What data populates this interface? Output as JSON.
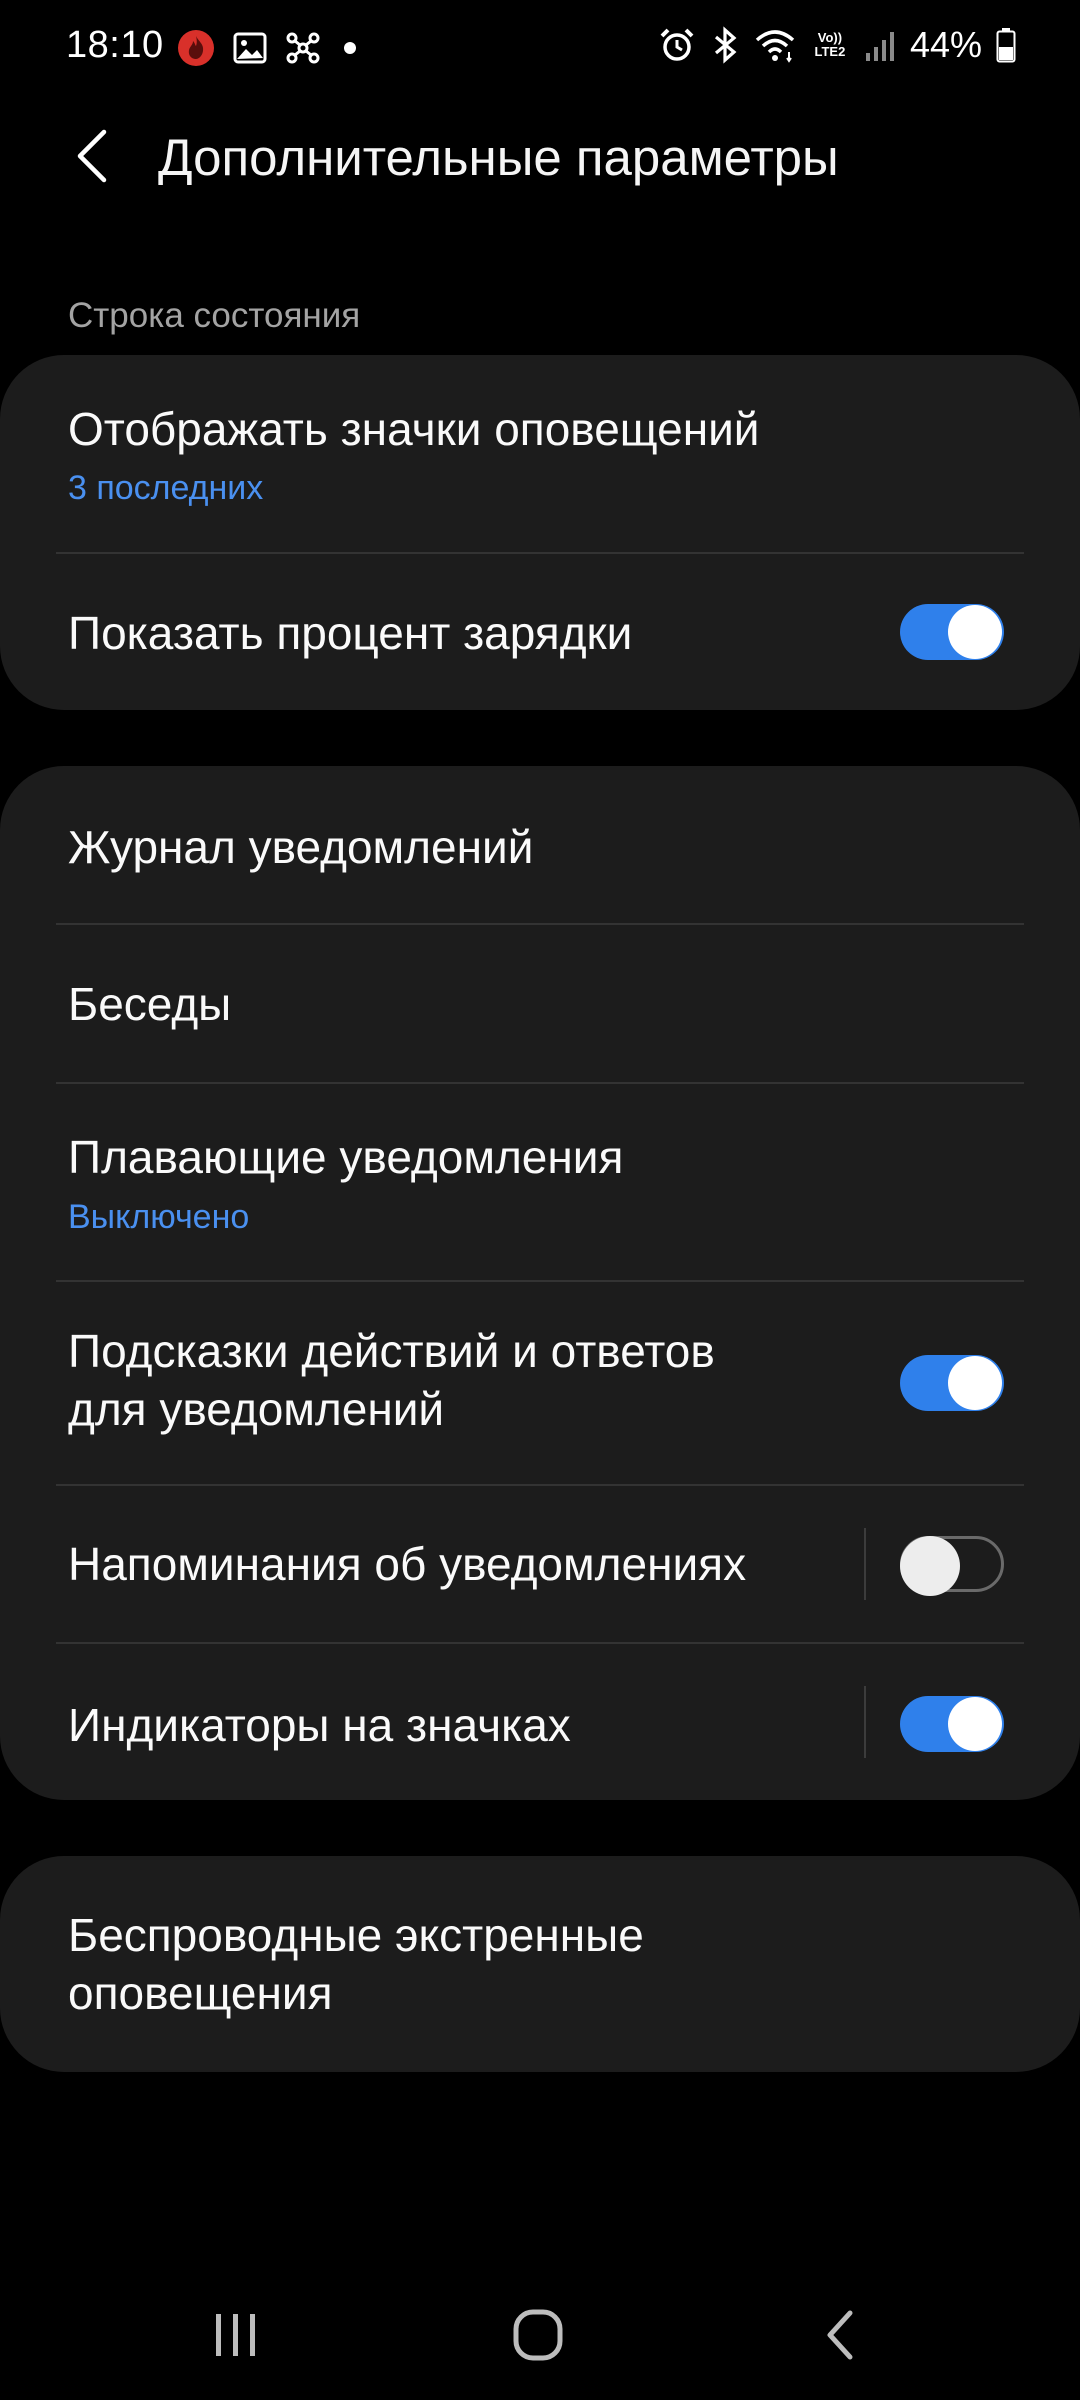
{
  "status_bar": {
    "time": "18:10",
    "volte_line1": "Vo))",
    "volte_line2": "LTE2",
    "battery_percent": "44%",
    "left_icons": [
      "fire-app-icon",
      "gallery-icon",
      "network-icon",
      "dot-icon"
    ],
    "right_icons": [
      "alarm-icon",
      "bluetooth-icon",
      "wifi-icon",
      "volte-icon",
      "signal-icon",
      "battery-icon"
    ]
  },
  "header": {
    "title": "Дополнительные параметры"
  },
  "status_section": {
    "label": "Строка состояния",
    "items": [
      {
        "title": "Отображать значки оповещений",
        "subtitle": "3 последних"
      },
      {
        "title": "Показать процент зарядки",
        "toggle": true
      }
    ]
  },
  "notifications_section": {
    "items": [
      {
        "title": "Журнал уведомлений"
      },
      {
        "title": "Беседы"
      },
      {
        "title": "Плавающие уведомления",
        "subtitle": "Выключено"
      },
      {
        "title_line1": "Подсказки действий и ответов",
        "title_line2": "для уведомлений",
        "toggle": true
      },
      {
        "title": "Напоминания об уведомлениях",
        "toggle": false
      },
      {
        "title": "Индикаторы на значках",
        "toggle": true
      }
    ]
  },
  "emergency_section": {
    "title_line1": "Беспроводные экстренные",
    "title_line2": "оповещения"
  },
  "colors": {
    "background": "#000000",
    "card": "#1C1C1C",
    "accent": "#2F80EB",
    "subtitle_link": "#4A90F0",
    "section_label": "#A3A3A3"
  },
  "nav_bar": {
    "buttons": [
      "recent-apps",
      "home",
      "back"
    ]
  }
}
